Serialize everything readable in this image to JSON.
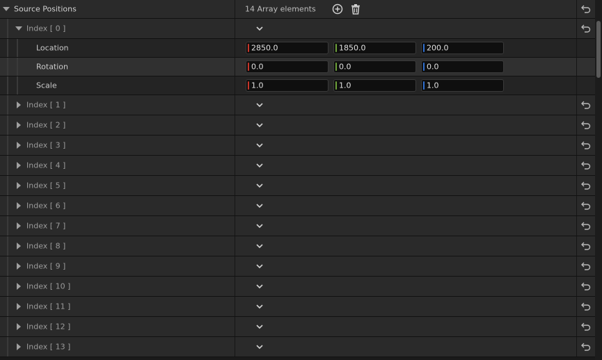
{
  "header": {
    "label": "Source Positions",
    "count": "14 Array elements"
  },
  "expanded_index": {
    "label": "Index [ 0 ]",
    "fields": [
      {
        "label": "Location",
        "x": "2850.0",
        "y": "1850.0",
        "z": "200.0"
      },
      {
        "label": "Rotation",
        "x": "0.0",
        "y": "0.0",
        "z": "0.0"
      },
      {
        "label": "Scale",
        "x": "1.0",
        "y": "1.0",
        "z": "1.0"
      }
    ]
  },
  "collapsed_indices": [
    "Index [ 1 ]",
    "Index [ 2 ]",
    "Index [ 3 ]",
    "Index [ 4 ]",
    "Index [ 5 ]",
    "Index [ 6 ]",
    "Index [ 7 ]",
    "Index [ 8 ]",
    "Index [ 9 ]",
    "Index [ 10 ]",
    "Index [ 11 ]",
    "Index [ 12 ]",
    "Index [ 13 ]"
  ],
  "colors": {
    "axis_x": "#c8362a",
    "axis_y": "#6ea33a",
    "axis_z": "#2f6fd0"
  },
  "icons": {
    "add": "plus-circle-icon",
    "delete": "trash-icon",
    "reset": "reset-arrow-icon",
    "expand": "chevron-down-icon"
  }
}
